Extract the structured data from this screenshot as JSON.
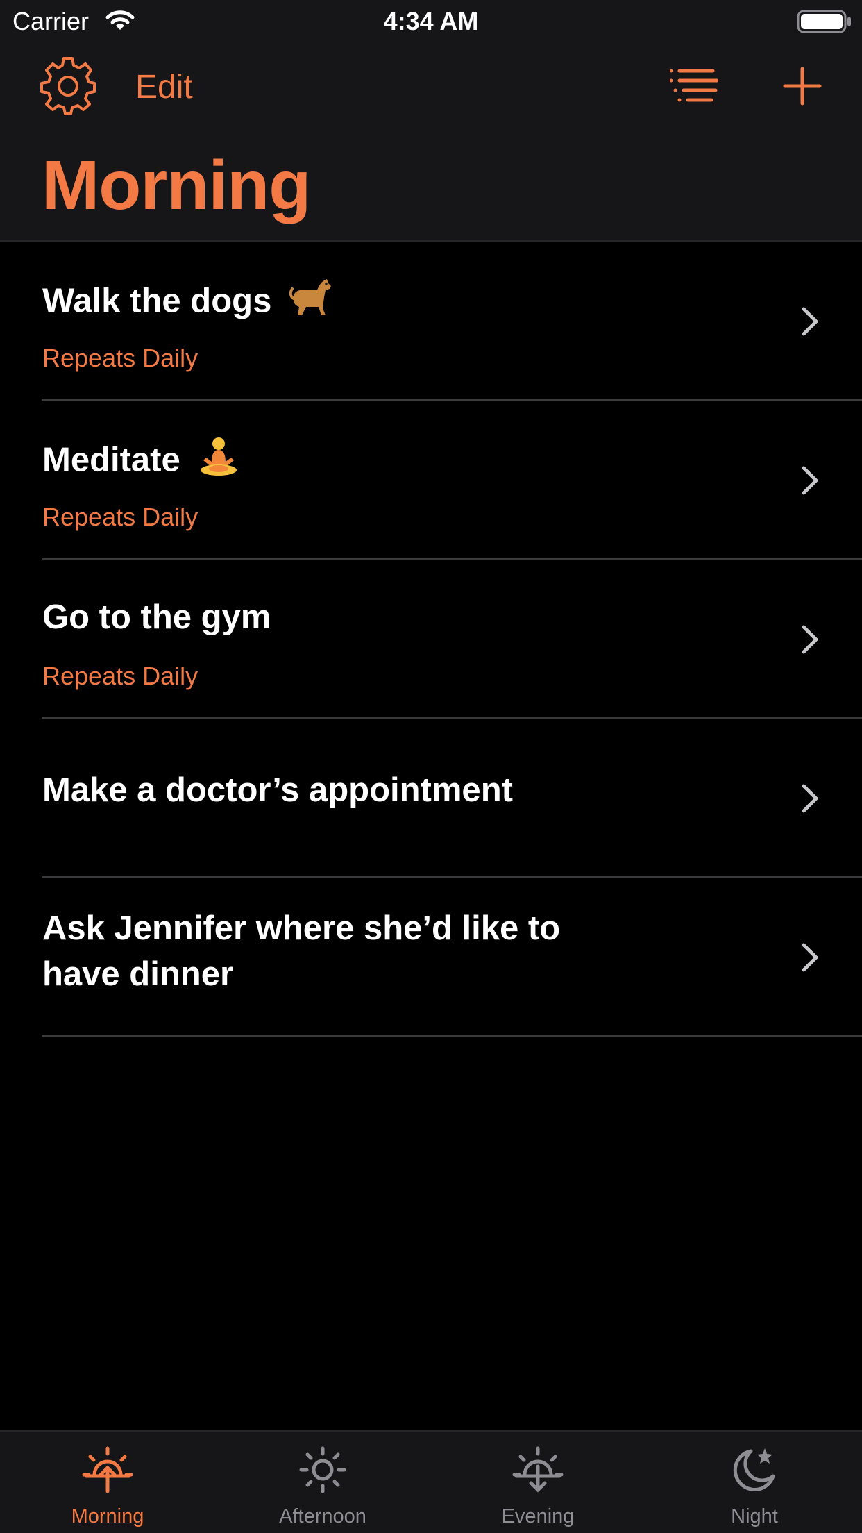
{
  "status_bar": {
    "carrier": "Carrier",
    "time": "4:34 AM"
  },
  "nav": {
    "edit_label": "Edit",
    "title": "Morning"
  },
  "colors": {
    "accent": "#f37a44",
    "background": "#000000",
    "bar": "#161618",
    "separator": "#3a3a3c",
    "inactive": "#8d8d93"
  },
  "tasks": [
    {
      "title": "Walk the dogs",
      "emoji_icon": "dog-icon",
      "subtitle": "Repeats Daily"
    },
    {
      "title": "Meditate",
      "emoji_icon": "meditating-person-icon",
      "subtitle": "Repeats Daily"
    },
    {
      "title": "Go to the gym",
      "subtitle": "Repeats Daily"
    },
    {
      "title": "Make a doctor’s appointment"
    },
    {
      "title": "Ask Jennifer where she’d like to have dinner"
    }
  ],
  "tabs": [
    {
      "label": "Morning",
      "icon": "sunrise-icon",
      "active": true
    },
    {
      "label": "Afternoon",
      "icon": "sun-icon",
      "active": false
    },
    {
      "label": "Evening",
      "icon": "sunset-icon",
      "active": false
    },
    {
      "label": "Night",
      "icon": "moon-stars-icon",
      "active": false
    }
  ]
}
